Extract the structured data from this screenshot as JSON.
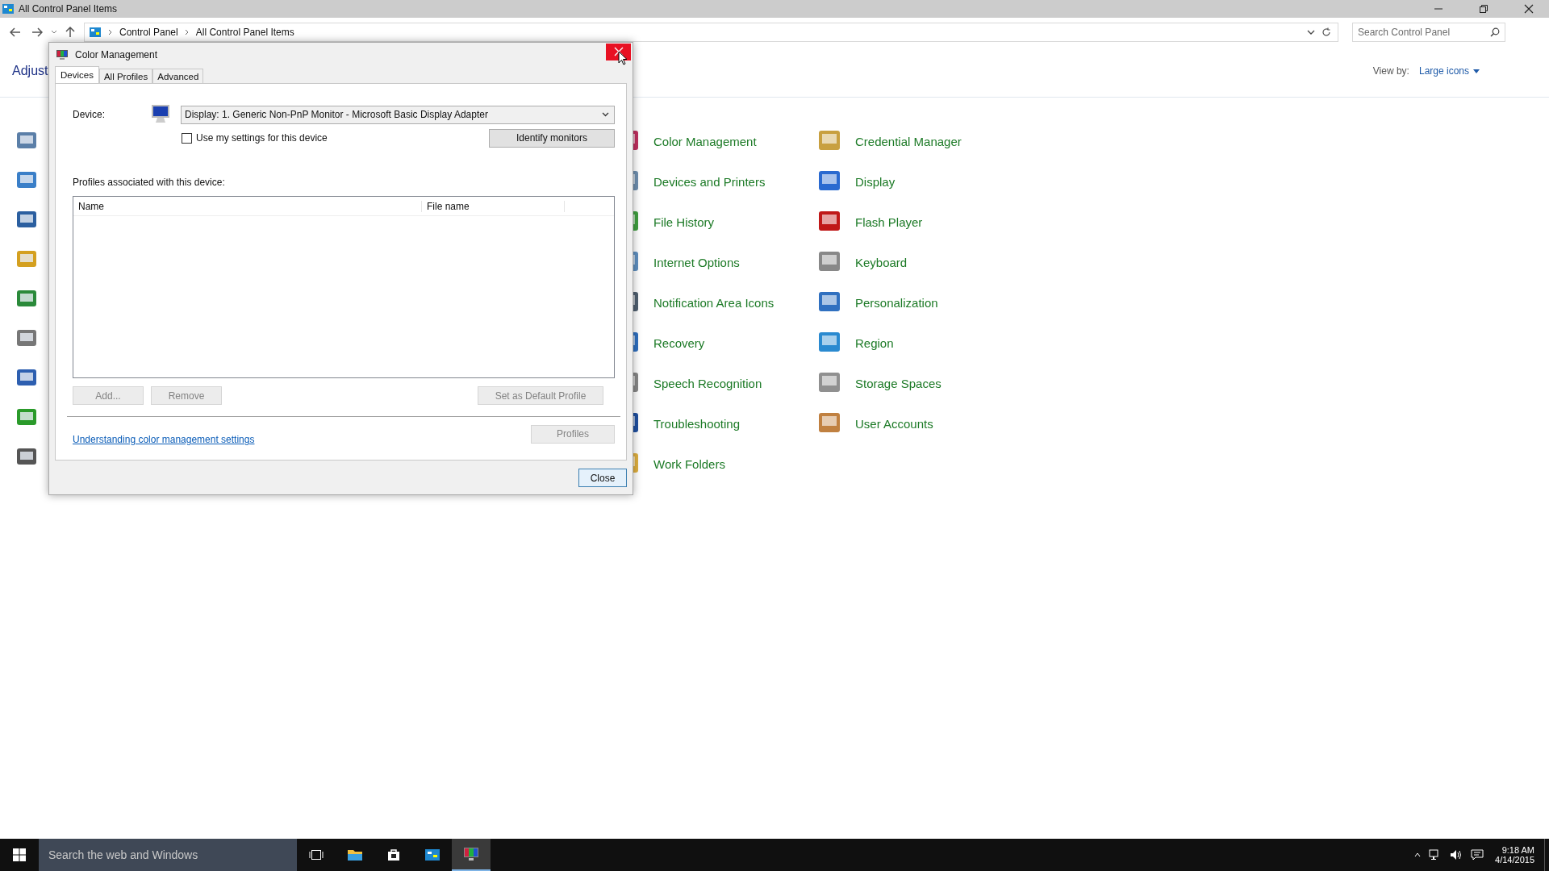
{
  "window": {
    "title": "All Control Panel Items"
  },
  "address_bar": {
    "breadcrumb": [
      "Control Panel",
      "All Control Panel Items"
    ]
  },
  "search": {
    "placeholder": "Search Control Panel"
  },
  "header": {
    "title": "Adjust",
    "view_by_label": "View by:",
    "view_by_value": "Large icons"
  },
  "items": [
    {
      "label": "Color Management"
    },
    {
      "label": "Credential Manager"
    },
    {
      "label": "Devices and Printers"
    },
    {
      "label": "Display"
    },
    {
      "label": "File History"
    },
    {
      "label": "Flash Player"
    },
    {
      "label": "Internet Options"
    },
    {
      "label": "Keyboard"
    },
    {
      "label": "Notification Area Icons"
    },
    {
      "label": "Personalization"
    },
    {
      "label": "Recovery"
    },
    {
      "label": "Region"
    },
    {
      "label": "Speech Recognition"
    },
    {
      "label": "Storage Spaces"
    },
    {
      "label": "Troubleshooting"
    },
    {
      "label": "User Accounts"
    },
    {
      "label": "Work Folders"
    }
  ],
  "dialog": {
    "title": "Color Management",
    "tabs": [
      {
        "label": "Devices",
        "selected": true
      },
      {
        "label": "All Profiles",
        "selected": false
      },
      {
        "label": "Advanced",
        "selected": false
      }
    ],
    "device_label": "Device:",
    "device_value": "Display: 1. Generic Non-PnP Monitor - Microsoft Basic Display Adapter",
    "checkbox": {
      "label": "Use my settings for this device",
      "checked": false
    },
    "identify_button": "Identify monitors",
    "profiles_label": "Profiles associated with this device:",
    "columns": [
      "Name",
      "File name"
    ],
    "buttons": [
      {
        "label": "Add...",
        "disabled": true
      },
      {
        "label": "Remove",
        "disabled": true
      },
      {
        "label": "Set as Default Profile",
        "disabled": true
      }
    ],
    "link": "Understanding color management settings",
    "profiles_button": {
      "label": "Profiles",
      "disabled": true
    },
    "close_button": "Close"
  },
  "taskbar": {
    "search_placeholder": "Search the web and Windows",
    "apps": [
      {
        "kind": "task-view",
        "selected": false
      },
      {
        "kind": "folder",
        "selected": false
      },
      {
        "kind": "store",
        "selected": false
      },
      {
        "kind": "control-panel",
        "selected": false
      },
      {
        "kind": "monitor",
        "selected": true
      }
    ],
    "time": "9:18 AM",
    "date": "4/14/2015"
  }
}
